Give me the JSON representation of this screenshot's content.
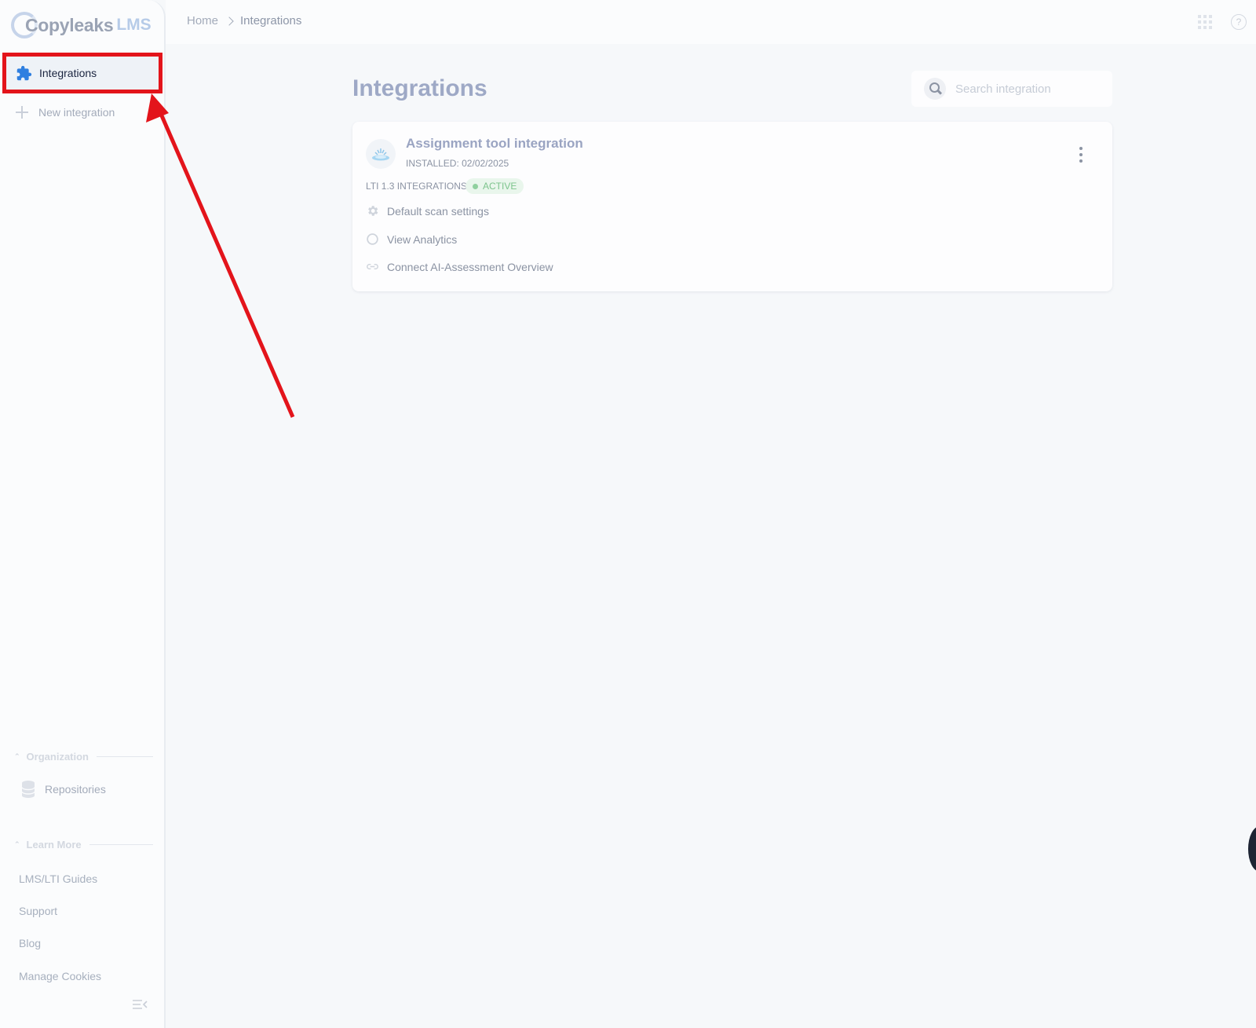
{
  "brand": {
    "name": "Copyleaks",
    "suffix": "LMS"
  },
  "sidebar": {
    "active_item": {
      "label": "Integrations",
      "icon": "puzzle-icon"
    },
    "new_integration": {
      "label": "New integration",
      "icon": "plus-icon"
    },
    "organization": {
      "heading": "Organization",
      "items": [
        {
          "label": "Repositories",
          "icon": "database-icon"
        }
      ]
    },
    "learn_more": {
      "heading": "Learn More",
      "links": [
        "LMS/LTI Guides",
        "Support",
        "Blog",
        "Manage Cookies"
      ]
    },
    "collapse_icon": "collapse-sidebar-icon"
  },
  "topbar": {
    "breadcrumb": {
      "home": "Home",
      "current": "Integrations"
    },
    "apps_icon": "apps-grid-icon",
    "help_icon": "help-circle-icon"
  },
  "main": {
    "title": "Integrations",
    "search": {
      "placeholder": "Search integration",
      "value": ""
    },
    "card": {
      "title": "Assignment tool integration",
      "installed": "INSTALLED: 02/02/2025",
      "type": "LTI 1.3 INTEGRATIONS",
      "status": "ACTIVE",
      "actions": [
        {
          "label": "Default scan settings",
          "icon": "gear-icon"
        },
        {
          "label": "View Analytics",
          "icon": "chart-circle-icon"
        },
        {
          "label": "Connect AI-Assessment Overview",
          "icon": "link-icon"
        }
      ]
    }
  },
  "colors": {
    "highlight": "#e3141b",
    "accent": "#2f7fe0",
    "active_green": "#7dc48d"
  }
}
